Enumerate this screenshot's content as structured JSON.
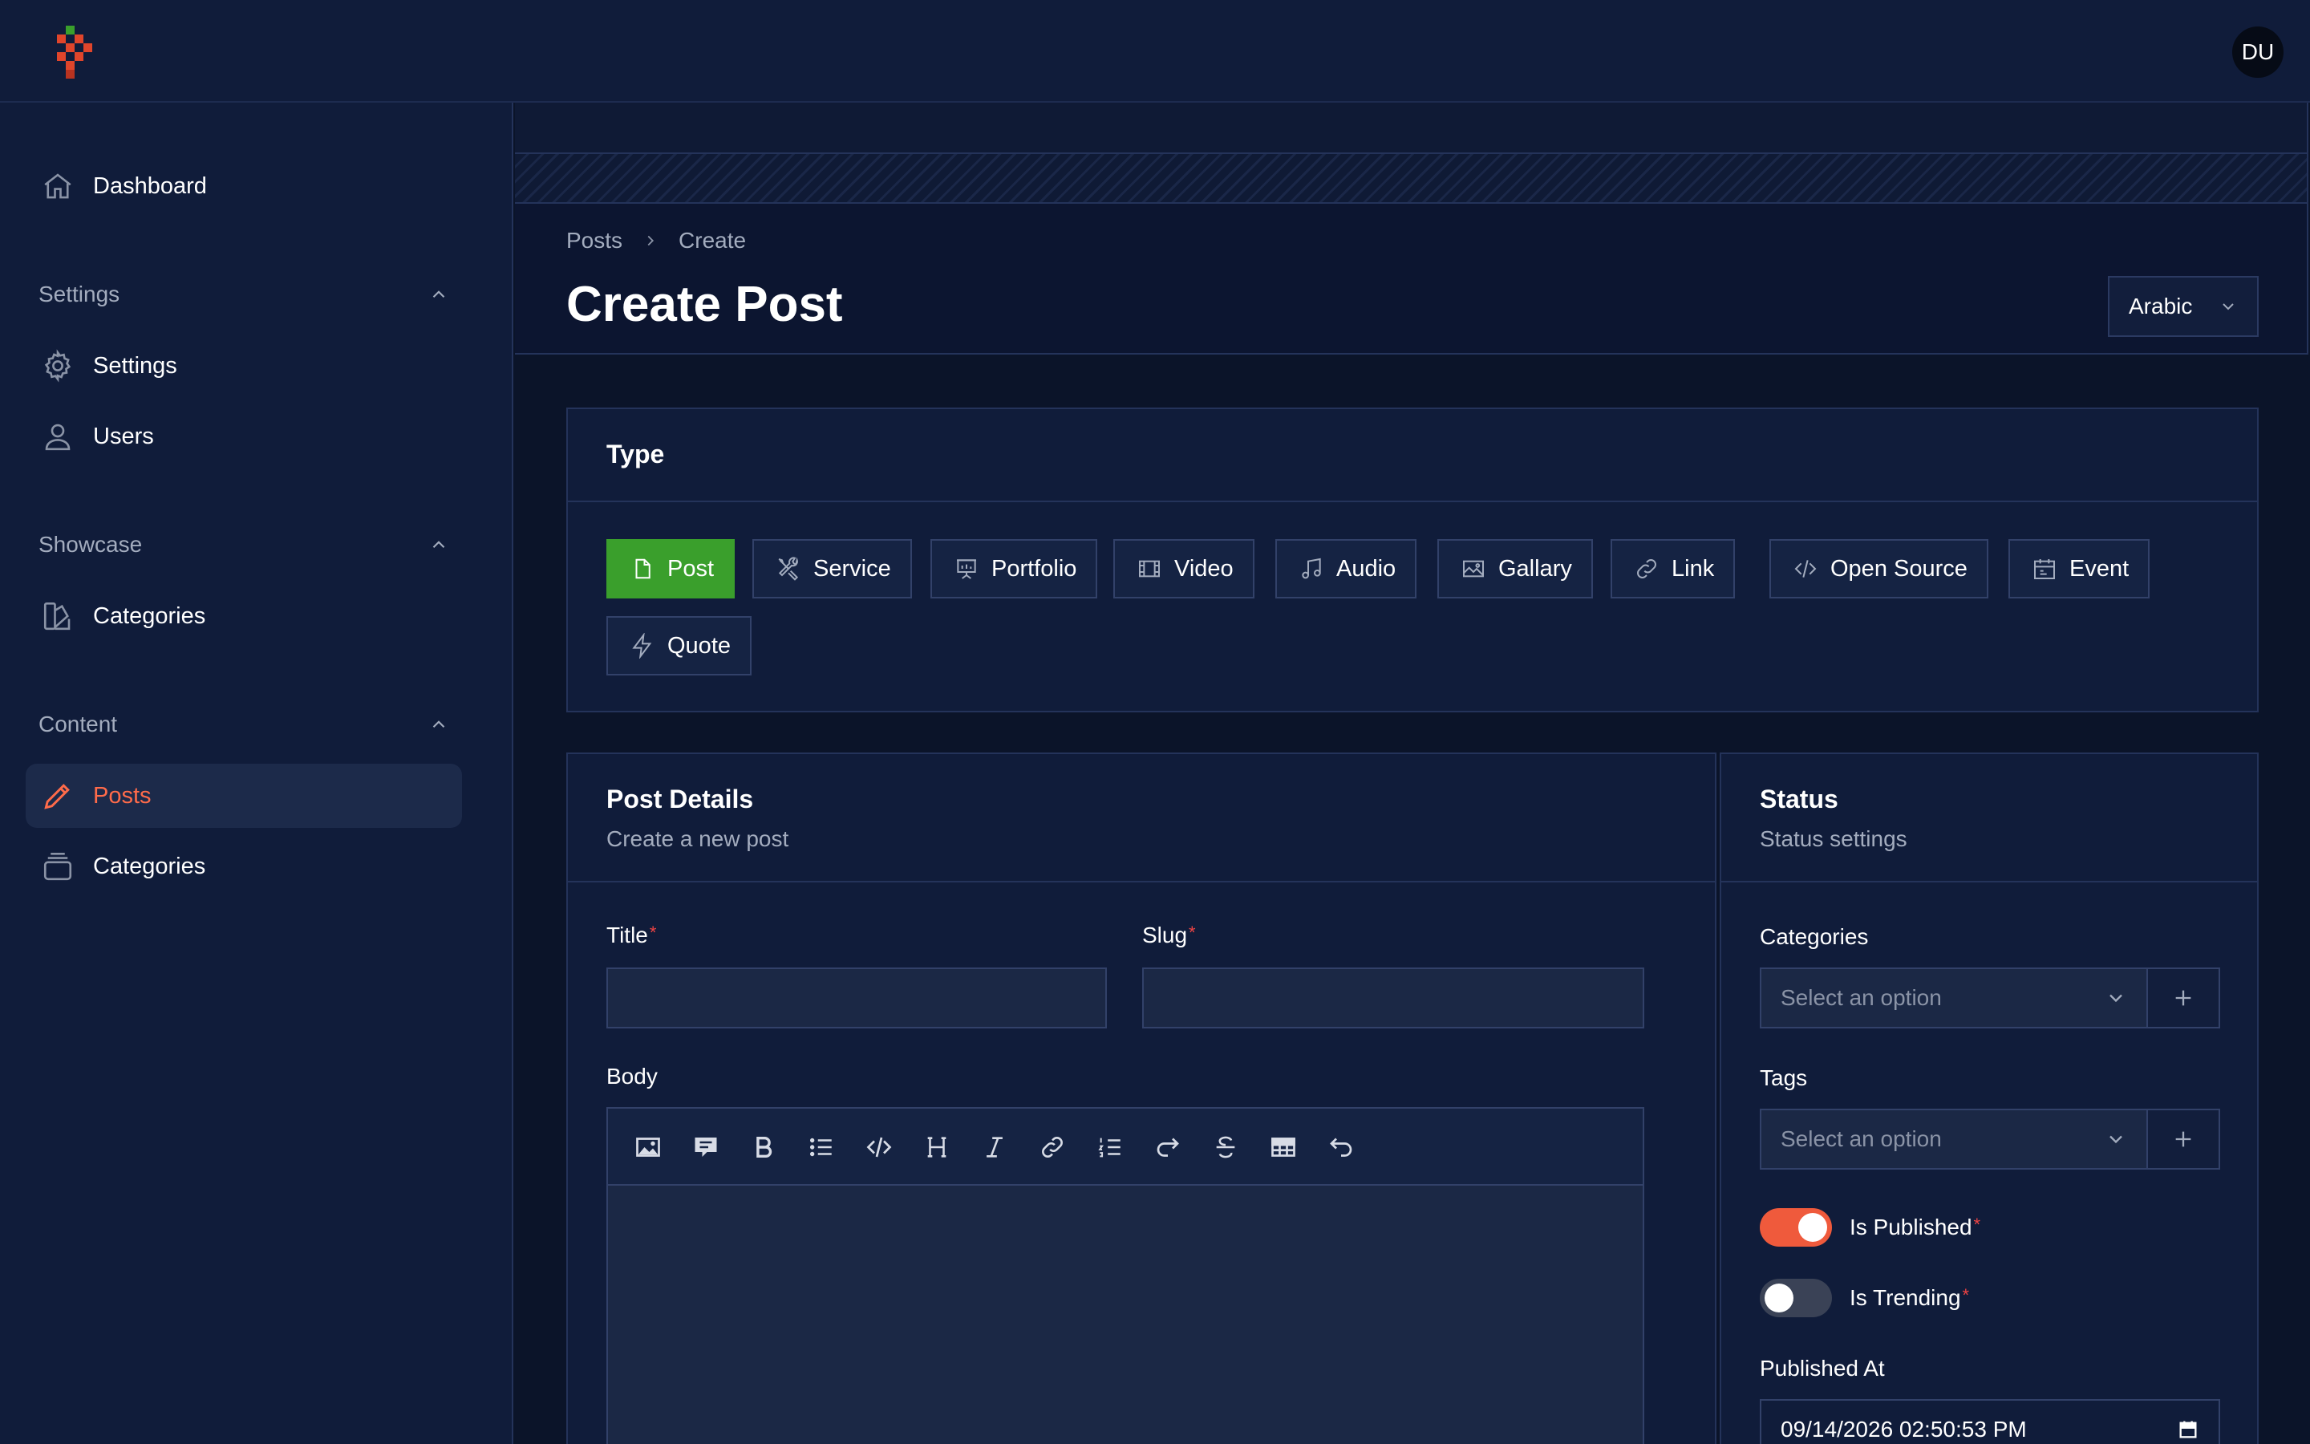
{
  "user": {
    "initials": "DU"
  },
  "sidebar": {
    "dashboard": "Dashboard",
    "groups": {
      "settings": {
        "label": "Settings",
        "items": [
          "Settings",
          "Users"
        ]
      },
      "showcase": {
        "label": "Showcase",
        "items": [
          "Categories"
        ]
      },
      "content": {
        "label": "Content",
        "items": [
          "Posts",
          "Categories"
        ]
      }
    }
  },
  "breadcrumb": {
    "parent": "Posts",
    "current": "Create"
  },
  "page": {
    "title": "Create Post",
    "language": "Arabic"
  },
  "type_card": {
    "title": "Type",
    "options": [
      "Post",
      "Service",
      "Portfolio",
      "Video",
      "Audio",
      "Gallary",
      "Link",
      "Open Source",
      "Event",
      "Quote"
    ],
    "selected": "Post"
  },
  "details_card": {
    "title": "Post Details",
    "subtitle": "Create a new post",
    "title_label": "Title",
    "slug_label": "Slug",
    "body_label": "Body",
    "required_mark": "*"
  },
  "status_card": {
    "title": "Status",
    "subtitle": "Status settings",
    "categories_label": "Categories",
    "categories_placeholder": "Select an option",
    "tags_label": "Tags",
    "tags_placeholder": "Select an option",
    "is_published_label": "Is Published",
    "is_published": true,
    "is_trending_label": "Is Trending",
    "is_trending": false,
    "published_at_label": "Published At",
    "published_at": "09/14/2026 02:50:53 PM"
  },
  "colors": {
    "accent": "#ff6b4a",
    "selected_type": "#3a9f2c",
    "background": "#0b1429",
    "panel": "#101c3a"
  }
}
